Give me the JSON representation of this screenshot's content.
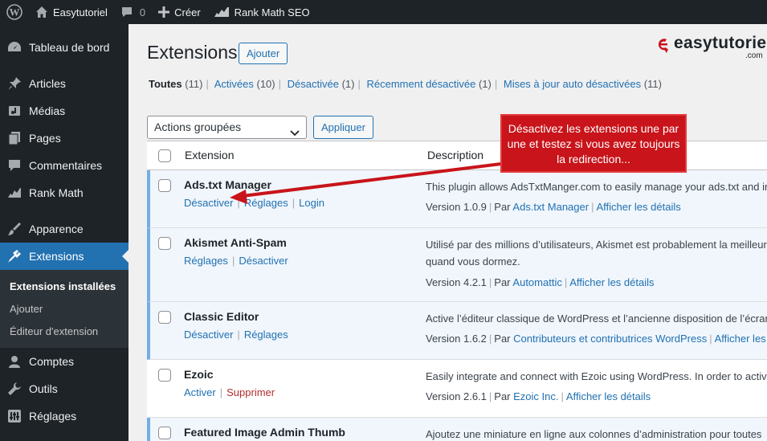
{
  "adminbar": {
    "site_name": "Easytutoriel",
    "comments_count": "0",
    "new_label": "Créer",
    "rankmath_label": "Rank Math SEO"
  },
  "sidebar": {
    "items": [
      {
        "label": "Tableau de bord",
        "icon": "dashboard-icon"
      },
      {
        "label": "Articles",
        "icon": "pin-icon"
      },
      {
        "label": "Médias",
        "icon": "media-icon"
      },
      {
        "label": "Pages",
        "icon": "pages-icon"
      },
      {
        "label": "Commentaires",
        "icon": "comment-icon"
      },
      {
        "label": "Rank Math",
        "icon": "rankmath-icon"
      },
      {
        "label": "Apparence",
        "icon": "brush-icon"
      },
      {
        "label": "Extensions",
        "icon": "plugin-icon"
      },
      {
        "label": "Comptes",
        "icon": "user-icon"
      },
      {
        "label": "Outils",
        "icon": "wrench-icon"
      },
      {
        "label": "Réglages",
        "icon": "settings-icon"
      }
    ],
    "submenu": [
      "Extensions installées",
      "Ajouter",
      "Éditeur d'extension"
    ]
  },
  "header": {
    "title": "Extensions",
    "add_label": "Ajouter",
    "brand": "easytutoriel",
    "brand_suffix": ".com"
  },
  "filters": [
    {
      "label": "Toutes",
      "count": "(11)"
    },
    {
      "label": "Activées",
      "count": "(10)"
    },
    {
      "label": "Désactivée",
      "count": "(1)"
    },
    {
      "label": "Récemment désactivée",
      "count": "(1)"
    },
    {
      "label": "Mises à jour auto désactivées",
      "count": "(11)"
    }
  ],
  "bulk": {
    "select_value": "Actions groupées",
    "apply_label": "Appliquer"
  },
  "table": {
    "col_extension": "Extension",
    "col_description": "Description",
    "rows": [
      {
        "name": "Ads.txt Manager",
        "actions": [
          "Désactiver",
          "Réglages",
          "Login"
        ],
        "desc": "This plugin allows AdsTxtManger.com to easily manage your ads.txt and in",
        "version": "Version 1.0.9",
        "by": "Par",
        "author": "Ads.txt Manager",
        "details": "Afficher les détails"
      },
      {
        "name": "Akismet Anti-Spam",
        "actions": [
          "Réglages",
          "Désactiver"
        ],
        "desc": "Utilisé par des millions d’utilisateurs, Akismet est probablement la meilleur",
        "desc2": "quand vous dormez.",
        "version": "Version 4.2.1",
        "by": "Par",
        "author": "Automattic",
        "details": "Afficher les détails"
      },
      {
        "name": "Classic Editor",
        "actions": [
          "Désactiver",
          "Réglages"
        ],
        "desc": "Active l’éditeur classique de WordPress et l’ancienne disposition de l’écran",
        "version": "Version 1.6.2",
        "by": "Par",
        "author": "Contributeurs et contributrices WordPress",
        "details": "Afficher les"
      },
      {
        "name": "Ezoic",
        "actions": [
          "Activer",
          "Supprimer"
        ],
        "desc": "Easily integrate and connect with Ezoic using WordPress. In order to activa",
        "version": "Version 2.6.1",
        "by": "Par",
        "author": "Ezoic Inc.",
        "details": "Afficher les détails"
      },
      {
        "name": "Featured Image Admin Thumb",
        "desc": "Ajoutez une miniature en ligne aux colonnes d’administration pour toutes"
      }
    ]
  },
  "callout": {
    "text": "Désactivez les extensions une par une et testez si vous avez toujours la redirection...",
    "color": "#c8141a"
  },
  "colors": {
    "accent": "#2271b1",
    "admin_dark": "#1d2327",
    "active_border": "#72aee6"
  }
}
